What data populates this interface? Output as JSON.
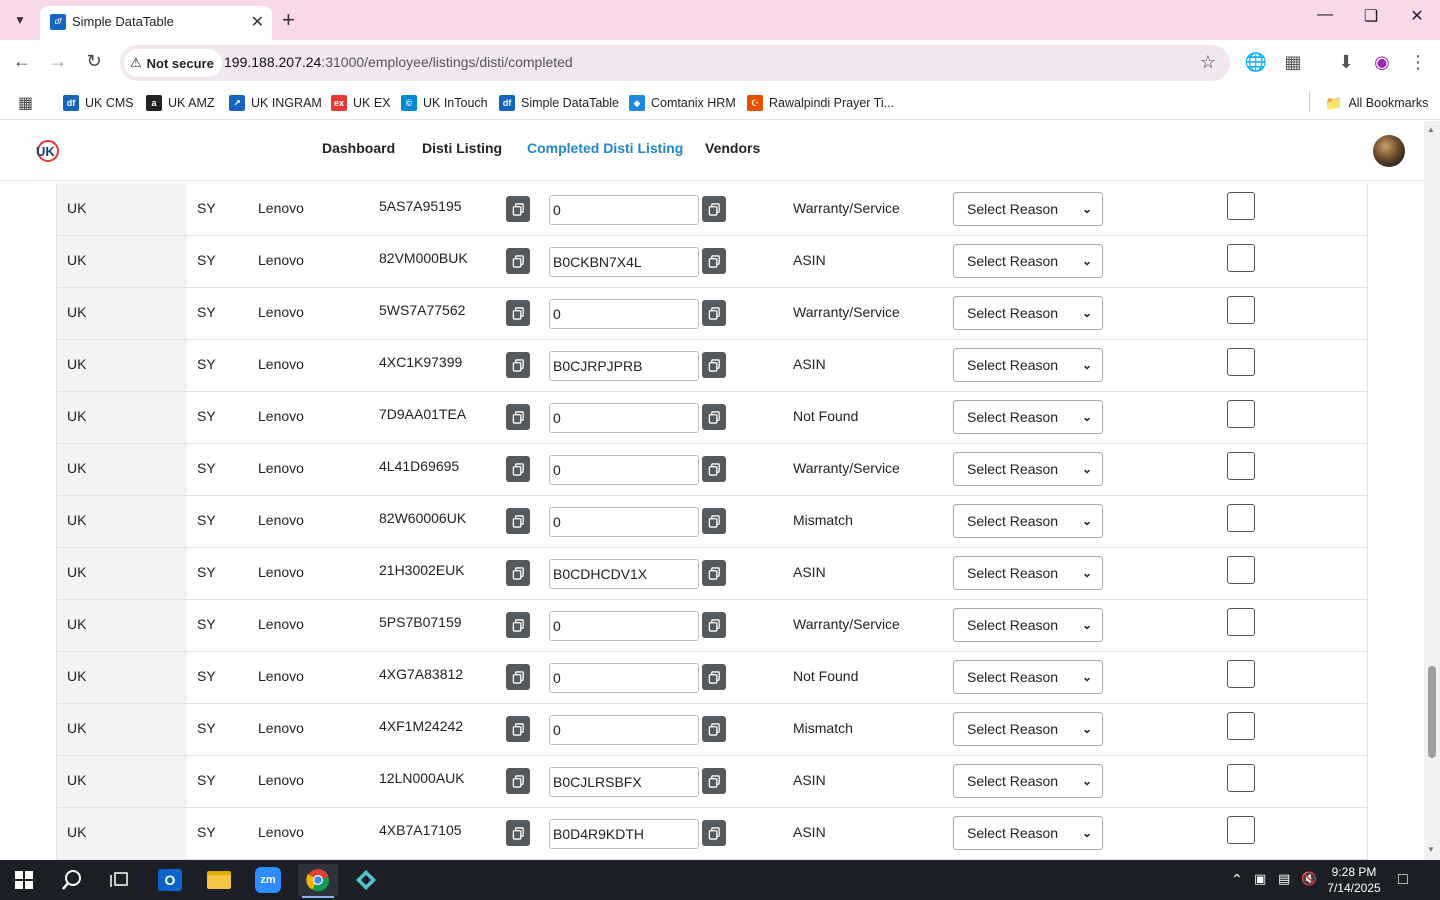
{
  "browser": {
    "tab_title": "Simple DataTable",
    "tab_favicon_text": "df",
    "security_label": "Not secure",
    "url_host": "199.188.207.24",
    "url_path": ":31000/employee/listings/disti/completed",
    "bookmarks": [
      {
        "label": "UK CMS",
        "icon_text": "df",
        "color": "#1565c0"
      },
      {
        "label": "UK AMZ",
        "icon_text": "a",
        "color": "#222222"
      },
      {
        "label": "UK INGRAM",
        "icon_text": "↗",
        "color": "#1565c0"
      },
      {
        "label": "UK EX",
        "icon_text": "ex",
        "color": "#e53935"
      },
      {
        "label": "UK InTouch",
        "icon_text": "©",
        "color": "#0288d1"
      },
      {
        "label": "Simple DataTable",
        "icon_text": "df",
        "color": "#1565c0"
      },
      {
        "label": "Comtanix HRM",
        "icon_text": "◆",
        "color": "#1e88e5"
      },
      {
        "label": "Rawalpindi Prayer Ti...",
        "icon_text": "☪",
        "color": "#e65100"
      }
    ],
    "all_bookmarks_label": "All Bookmarks"
  },
  "nav": {
    "logo_text": "UK",
    "links": [
      "Dashboard",
      "Disti Listing",
      "Completed Disti Listing",
      "Vendors"
    ],
    "active_index": 2
  },
  "colors": {
    "accent": "#1e88c7",
    "copy_button": "#555a5f",
    "tab_strip": "#f7d9ea"
  },
  "table": {
    "select_placeholder": "Select Reason",
    "rows": [
      {
        "country": "UK",
        "code": "SY",
        "vendor": "Lenovo",
        "part": "5AS7A95195",
        "asin": "0",
        "status": "Warranty/Service"
      },
      {
        "country": "UK",
        "code": "SY",
        "vendor": "Lenovo",
        "part": "82VM000BUK",
        "asin": "B0CKBN7X4L",
        "status": "ASIN"
      },
      {
        "country": "UK",
        "code": "SY",
        "vendor": "Lenovo",
        "part": "5WS7A77562",
        "asin": "0",
        "status": "Warranty/Service"
      },
      {
        "country": "UK",
        "code": "SY",
        "vendor": "Lenovo",
        "part": "4XC1K97399",
        "asin": "B0CJRPJPRB",
        "status": "ASIN"
      },
      {
        "country": "UK",
        "code": "SY",
        "vendor": "Lenovo",
        "part": "7D9AA01TEA",
        "asin": "0",
        "status": "Not Found"
      },
      {
        "country": "UK",
        "code": "SY",
        "vendor": "Lenovo",
        "part": "4L41D69695",
        "asin": "0",
        "status": "Warranty/Service"
      },
      {
        "country": "UK",
        "code": "SY",
        "vendor": "Lenovo",
        "part": "82W60006UK",
        "asin": "0",
        "status": "Mismatch"
      },
      {
        "country": "UK",
        "code": "SY",
        "vendor": "Lenovo",
        "part": "21H3002EUK",
        "asin": "B0CDHCDV1X",
        "status": "ASIN"
      },
      {
        "country": "UK",
        "code": "SY",
        "vendor": "Lenovo",
        "part": "5PS7B07159",
        "asin": "0",
        "status": "Warranty/Service"
      },
      {
        "country": "UK",
        "code": "SY",
        "vendor": "Lenovo",
        "part": "4XG7A83812",
        "asin": "0",
        "status": "Not Found"
      },
      {
        "country": "UK",
        "code": "SY",
        "vendor": "Lenovo",
        "part": "4XF1M24242",
        "asin": "0",
        "status": "Mismatch"
      },
      {
        "country": "UK",
        "code": "SY",
        "vendor": "Lenovo",
        "part": "12LN000AUK",
        "asin": "B0CJLRSBFX",
        "status": "ASIN"
      },
      {
        "country": "UK",
        "code": "SY",
        "vendor": "Lenovo",
        "part": "4XB7A17105",
        "asin": "B0D4R9KDTH",
        "status": "ASIN"
      }
    ]
  },
  "taskbar": {
    "time": "9:28 PM",
    "date": "7/14/2025",
    "apps": [
      "start-icon",
      "search-icon",
      "task-view-icon",
      "outlook-icon",
      "file-explorer-icon",
      "zoom-icon",
      "chrome-icon",
      "app-icon"
    ]
  }
}
